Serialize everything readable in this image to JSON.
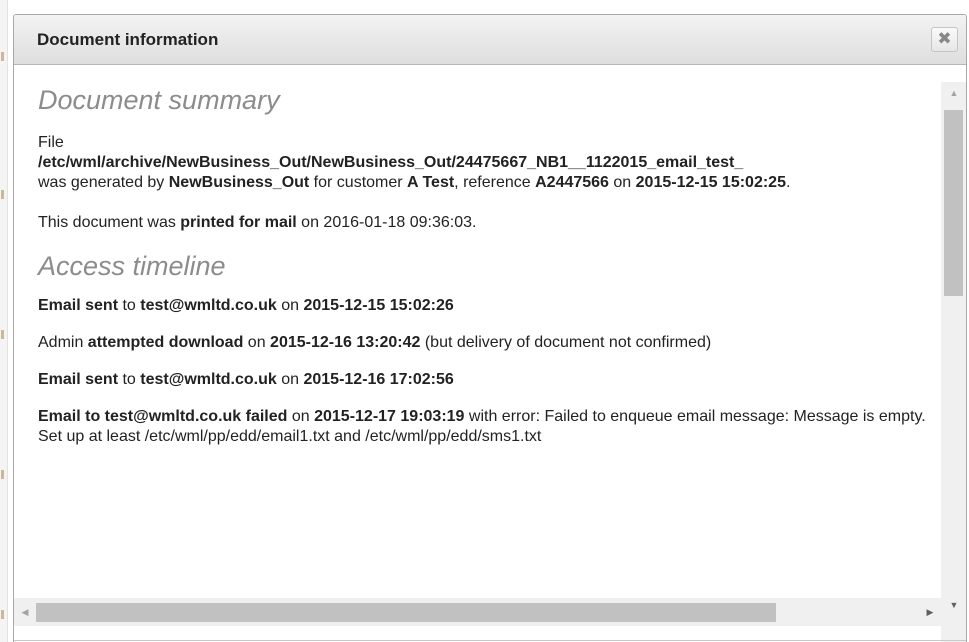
{
  "dialog": {
    "title": "Document information",
    "close_label": "✖"
  },
  "summary": {
    "heading": "Document summary",
    "file_label": "File",
    "file_path": "/etc/wml/archive/NewBusiness_Out/NewBusiness_Out/24475667_NB1__1122015_email_test_",
    "gen_prefix": "was generated by ",
    "generator": "NewBusiness_Out",
    "gen_customer_prefix": " for customer ",
    "customer": "A Test",
    "gen_reference_prefix": ", reference ",
    "reference": "A2447566",
    "gen_on": " on ",
    "generated_at": "2015-12-15 15:02:25",
    "gen_end": ".",
    "printed_prefix": "This document was ",
    "printed_action": "printed for mail",
    "printed_on": " on 2016-01-18 09:36:03."
  },
  "timeline": {
    "heading": "Access timeline",
    "entry1": {
      "action": "Email sent",
      "to_prefix": " to ",
      "recipient": "test@wmltd.co.uk",
      "on": " on ",
      "timestamp": "2015-12-15 15:02:26"
    },
    "entry2": {
      "actor": "Admin ",
      "action": "attempted download",
      "on": " on ",
      "timestamp": "2015-12-16 13:20:42",
      "note": " (but delivery of document not confirmed)"
    },
    "entry3": {
      "action": "Email sent",
      "to_prefix": " to ",
      "recipient": "test@wmltd.co.uk",
      "on": " on ",
      "timestamp": "2015-12-16 17:02:56"
    },
    "entry4": {
      "action": "Email to test@wmltd.co.uk failed",
      "on": " on ",
      "timestamp": "2015-12-17 19:03:19",
      "error": " with error: Failed to enqueue email message: Message is empty. Set up at least /etc/wml/pp/edd/email1.txt and /etc/wml/pp/edd/sms1.txt"
    }
  },
  "scrollbars": {
    "up_icon": "▲",
    "down_icon": "▼",
    "left_icon": "◀",
    "right_icon": "▶"
  }
}
